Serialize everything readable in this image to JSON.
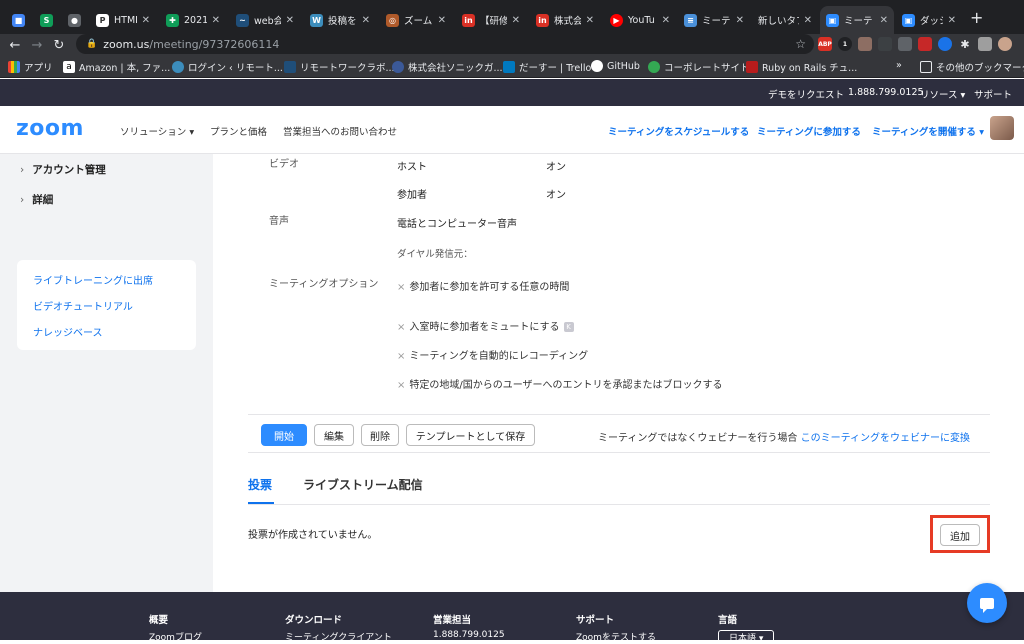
{
  "browser": {
    "tabs": [
      {
        "label": "",
        "color": "#4285f4"
      },
      {
        "label": "",
        "color": "#0f9d58"
      },
      {
        "label": "",
        "color": "#5f6368"
      },
      {
        "label": "HTML",
        "color": "#ffffff"
      },
      {
        "label": "2021",
        "color": "#0f9d58"
      },
      {
        "label": "web会",
        "color": "#1f4e79"
      },
      {
        "label": "投稿を",
        "color": "#3c8dbc"
      },
      {
        "label": "ズーム",
        "color": "#b05a2a"
      },
      {
        "label": "【研修",
        "color": "#d93025"
      },
      {
        "label": "株式会",
        "color": "#d93025"
      },
      {
        "label": "YouTu",
        "color": "#ff0000"
      },
      {
        "label": "ミーテ",
        "color": "#4a90d9"
      },
      {
        "label": "新しいタブ",
        "color": "#35363a"
      },
      {
        "label": "ミーテ",
        "color": "#2d8cff"
      },
      {
        "label": "ダッシ",
        "color": "#2d8cff"
      }
    ],
    "url_host": "zoom.us",
    "url_path": "/meeting/97372606114",
    "bookmarks": [
      "アプリ",
      "Amazon | 本, ファ...",
      "ログイン ‹ リモート...",
      "リモートワークラボ...",
      "株式会社ソニックガ...",
      "だーすー | Trello",
      "GitHub",
      "コーポレートサイト",
      "Ruby on Rails チュ...",
      "その他のブックマーク"
    ]
  },
  "topstrip": {
    "demo": "デモをリクエスト",
    "phone": "1.888.799.0125",
    "resources": "リソース ▾",
    "support": "サポート"
  },
  "header": {
    "logo": "zoom",
    "nav": [
      "ソリューション ▾",
      "プランと価格",
      "営業担当へのお問い合わせ"
    ],
    "actions": [
      "ミーティングをスケジュールする",
      "ミーティングに参加する",
      "ミーティングを開催する ▾"
    ]
  },
  "sidebar": {
    "items": [
      "アカウント管理",
      "詳細"
    ],
    "links": [
      "ライブトレーニングに出席",
      "ビデオチュートリアル",
      "ナレッジベース"
    ]
  },
  "settings": {
    "video_label": "ビデオ",
    "host_label": "ホスト",
    "host_value": "オン",
    "participant_label": "参加者",
    "participant_value": "オン",
    "audio_label": "音声",
    "audio_value": "電話とコンピューター音声",
    "dial_label": "ダイヤル発信元：",
    "options_label": "ミーティングオプション",
    "options": [
      "参加者に参加を許可する任意の時間",
      "入室時に参加者をミュートにする",
      "ミーティングを自動的にレコーディング",
      "特定の地域/国からのユーザーへのエントリを承認またはブロックする"
    ]
  },
  "actions": {
    "start": "開始",
    "edit": "編集",
    "delete": "削除",
    "save_template": "テンプレートとして保存",
    "webinar_note": "ミーティングではなくウェビナーを行う場合",
    "webinar_link": "このミーティングをウェビナーに変換"
  },
  "tabs": {
    "poll": "投票",
    "live": "ライブストリーム配信"
  },
  "poll": {
    "empty": "投票が作成されていません。",
    "add": "追加"
  },
  "footer": {
    "cols": [
      {
        "head": "概要",
        "link": "Zoomブログ"
      },
      {
        "head": "ダウンロード",
        "link": "ミーティングクライアント"
      },
      {
        "head": "営業担当",
        "link": "1.888.799.0125"
      },
      {
        "head": "サポート",
        "link": "Zoomをテストする"
      },
      {
        "head": "言語",
        "link": "日本語 ▾"
      }
    ]
  }
}
